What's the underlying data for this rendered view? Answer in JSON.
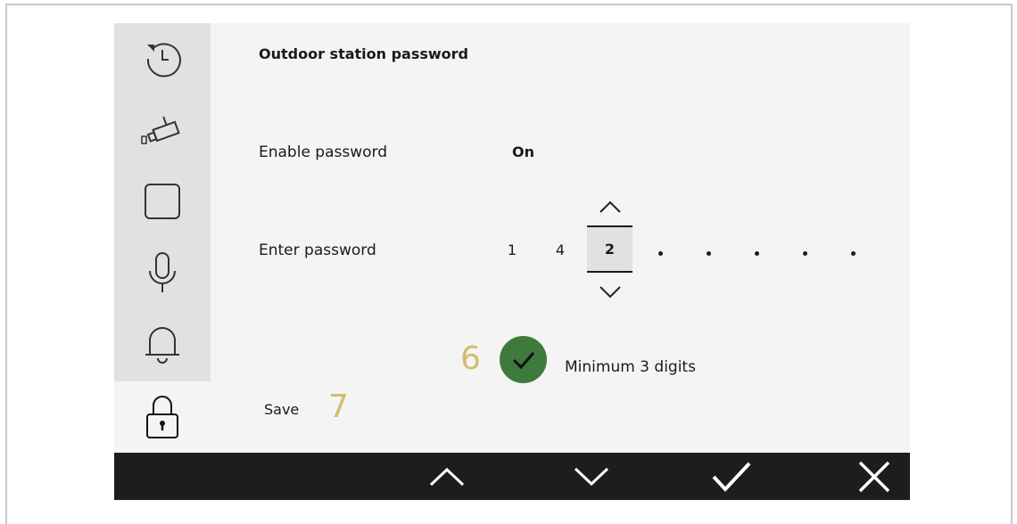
{
  "page": {
    "title": "Outdoor station password"
  },
  "sidebar": {
    "items": [
      {
        "icon": "history-icon"
      },
      {
        "icon": "camera-icon"
      },
      {
        "icon": "square-icon"
      },
      {
        "icon": "microphone-icon"
      },
      {
        "icon": "bell-icon"
      },
      {
        "icon": "lock-icon",
        "active": true
      }
    ]
  },
  "settings": {
    "enable_password_label": "Enable password",
    "enable_password_value": "On",
    "enter_password_label": "Enter password",
    "digits": [
      "1",
      "4"
    ],
    "current_digit": "2",
    "remaining_placeholder_count": 5
  },
  "validation": {
    "message": "Minimum 3 digits",
    "callout": "6"
  },
  "save": {
    "label": "Save",
    "callout": "7"
  },
  "bottombar": {
    "buttons": [
      "up-icon",
      "down-icon",
      "confirm-icon",
      "close-icon"
    ]
  },
  "colors": {
    "accent_green": "#3f7a3d",
    "callout": "#d4bc6b",
    "bar": "#1d1d1d",
    "sidebar": "#e1e1e1"
  }
}
